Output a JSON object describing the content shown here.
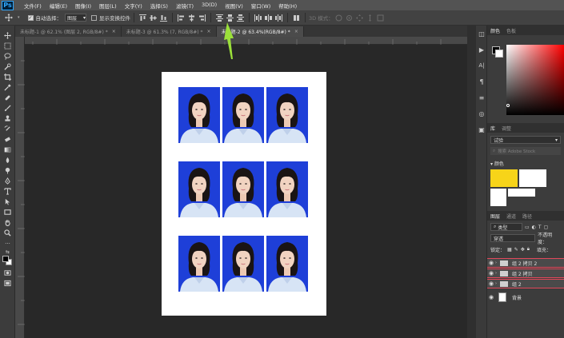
{
  "app": {
    "logo": "Ps"
  },
  "menu": [
    "文件(F)",
    "编辑(E)",
    "图像(I)",
    "图层(L)",
    "文字(Y)",
    "选择(S)",
    "滤镜(T)",
    "3D(D)",
    "视图(V)",
    "窗口(W)",
    "帮助(H)"
  ],
  "options": {
    "auto_select_label": "自动选择：",
    "auto_select_value": "图层",
    "show_transform_label": "显示变换控件",
    "mode_3d_label": "3D 模式："
  },
  "tabs": [
    {
      "title": "未标题-1 @ 62.1% (图层 2, RGB/8#) *",
      "active": false
    },
    {
      "title": "未标题-3 @ 61.3% (7, RGB/8#) *",
      "active": false
    },
    {
      "title": "未标题-2 @ 63.4%(RGB/8#) *",
      "active": true
    }
  ],
  "colors": {
    "photo_bg": "#1e3fd8",
    "annotation_arrow": "#9be03a",
    "swatch_yellow": "#f7d419",
    "layer_highlight": "#e0485a"
  },
  "document": {
    "rows": 3,
    "cols": 3
  },
  "panels": {
    "color_tabs": [
      "颜色",
      "色板"
    ],
    "library_tabs": [
      "库",
      "调整"
    ],
    "library_name": "试验",
    "library_search": "搜索 Adobe Stock",
    "library_section": "颜色",
    "layers_tabs": [
      "图层",
      "通道",
      "路径"
    ],
    "layers_filter": "类型",
    "blend_mode": "穿透",
    "opacity_label": "不透明度：",
    "lock_label": "锁定：",
    "fill_label": "填充：",
    "layers": [
      {
        "name": "组 2 拷贝 2",
        "type": "group"
      },
      {
        "name": "组 2 拷贝",
        "type": "group"
      },
      {
        "name": "组 2",
        "type": "group"
      },
      {
        "name": "背景",
        "type": "background"
      }
    ]
  },
  "icons": {
    "move": "move-icon",
    "eye": "eye-icon",
    "folder": "folder-icon"
  }
}
